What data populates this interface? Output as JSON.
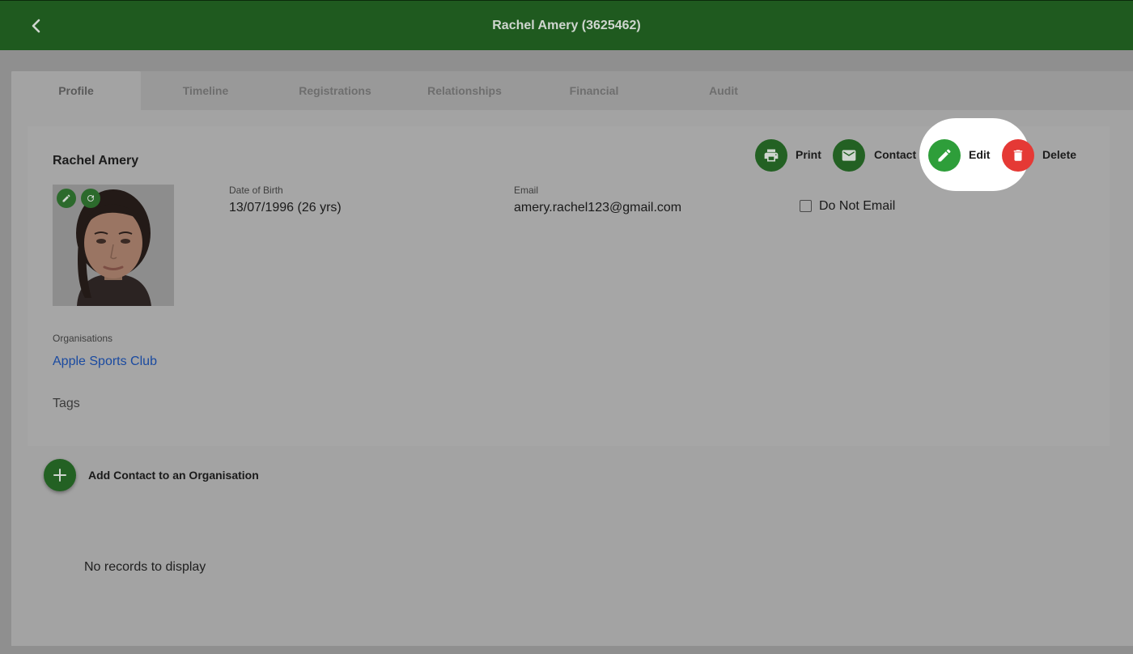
{
  "header": {
    "title": "Rachel Amery (3625462)",
    "back_icon": "chevron-left-icon"
  },
  "tabs": [
    {
      "label": "Profile",
      "active": true
    },
    {
      "label": "Timeline",
      "active": false
    },
    {
      "label": "Registrations",
      "active": false
    },
    {
      "label": "Relationships",
      "active": false
    },
    {
      "label": "Financial",
      "active": false
    },
    {
      "label": "Audit",
      "active": false
    }
  ],
  "profile": {
    "name": "Rachel Amery",
    "photo_actions": [
      "pencil-icon",
      "refresh-icon"
    ],
    "dob_label": "Date of Birth",
    "dob_value": "13/07/1996 (26 yrs)",
    "email_label": "Email",
    "email_value": "amery.rachel123@gmail.com",
    "do_not_email_label": "Do Not Email",
    "do_not_email_checked": false,
    "organisations_label": "Organisations",
    "organisation": "Apple Sports Club",
    "tags_label": "Tags"
  },
  "actions": {
    "print": {
      "label": "Print",
      "icon": "printer-icon",
      "color": "#236123"
    },
    "contact": {
      "label": "Contact",
      "icon": "envelope-icon",
      "color": "#236123"
    },
    "edit": {
      "label": "Edit",
      "icon": "pencil-icon",
      "color": "#2e9e3a"
    },
    "delete": {
      "label": "Delete",
      "icon": "trash-icon",
      "color": "#e53935"
    }
  },
  "organisations_section": {
    "add_label": "Add Contact to an Organisation",
    "empty_text": "No records to display"
  },
  "colors": {
    "header_bg": "#1f5a1f",
    "accent_green": "#2e9e3a",
    "danger_red": "#e53935",
    "link_blue": "#1a4aa0"
  }
}
